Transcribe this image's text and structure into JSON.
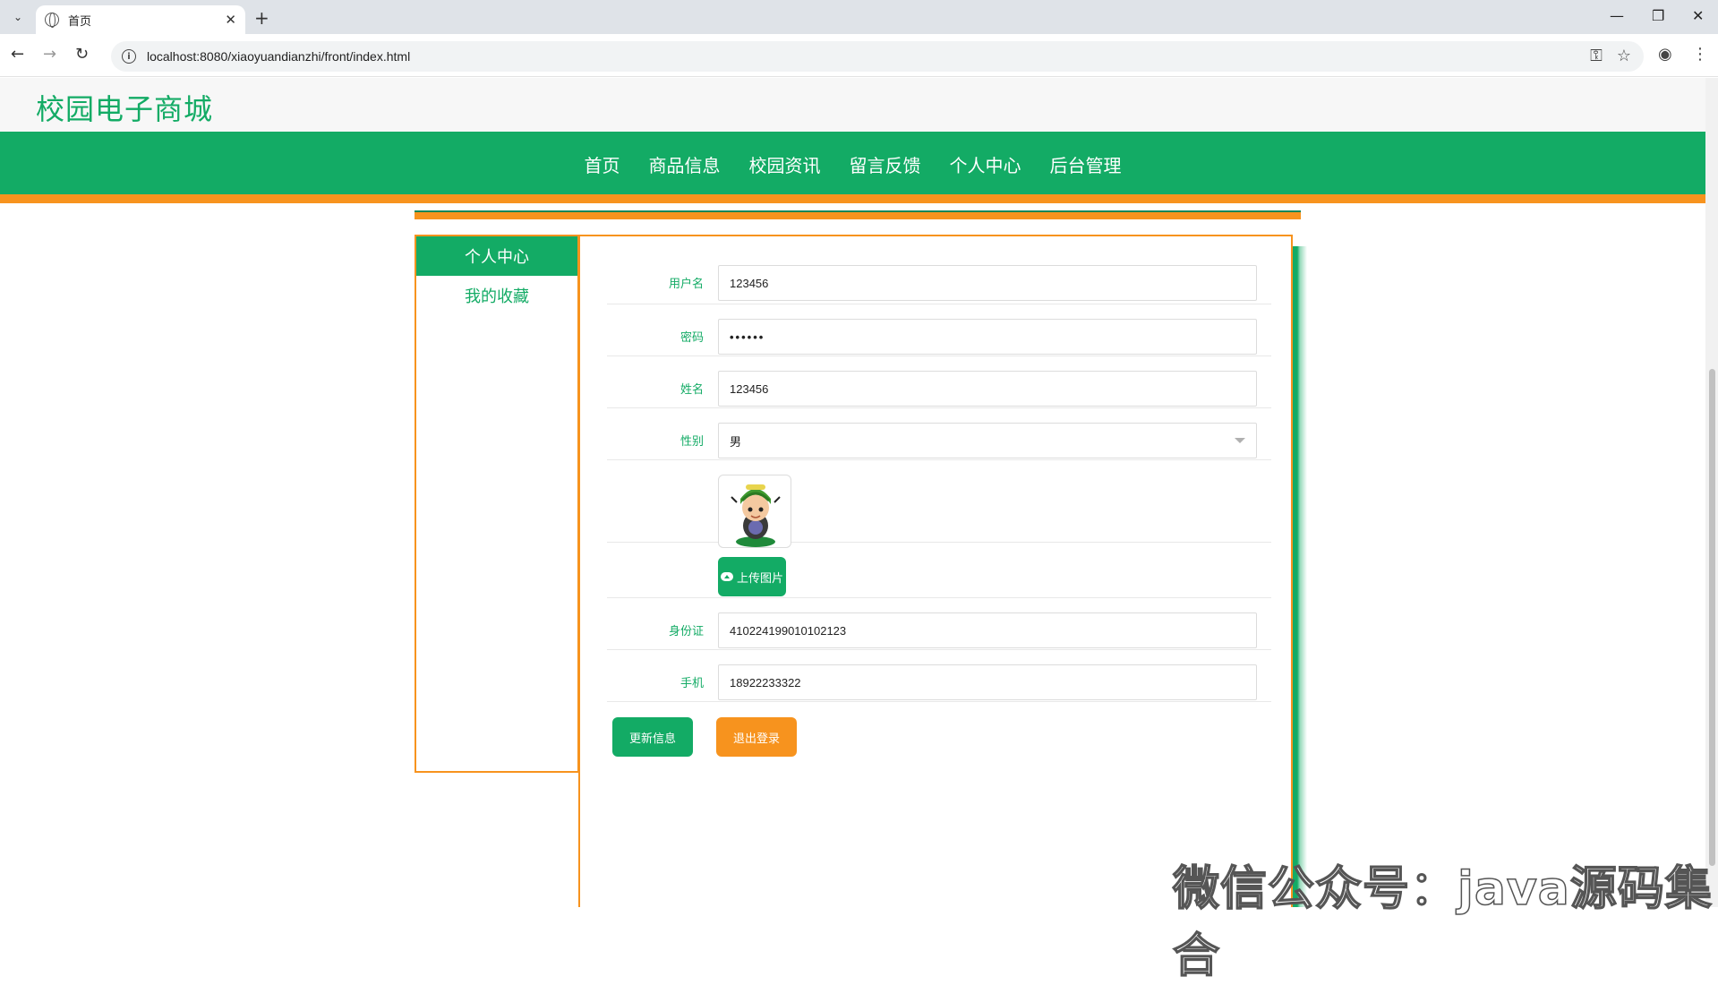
{
  "browser": {
    "tab_title": "首页",
    "url": "localhost:8080/xiaoyuandianzhi/front/index.html"
  },
  "site": {
    "title": "校园电子商城"
  },
  "nav": [
    "首页",
    "商品信息",
    "校园资讯",
    "留言反馈",
    "个人中心",
    "后台管理"
  ],
  "sidebar": {
    "header": "个人中心",
    "items": [
      "我的收藏"
    ]
  },
  "form": {
    "username_label": "用户名",
    "username_value": "123456",
    "password_label": "密码",
    "password_value": "••••••",
    "name_label": "姓名",
    "name_value": "123456",
    "gender_label": "性别",
    "gender_value": "男",
    "upload_label": "上传图片",
    "idcard_label": "身份证",
    "idcard_value": "410224199010102123",
    "phone_label": "手机",
    "phone_value": "18922233322"
  },
  "buttons": {
    "update": "更新信息",
    "logout": "退出登录"
  },
  "watermark": "微信公众号：java源码集合",
  "colors": {
    "primary": "#13ab65",
    "accent": "#f7931e"
  }
}
